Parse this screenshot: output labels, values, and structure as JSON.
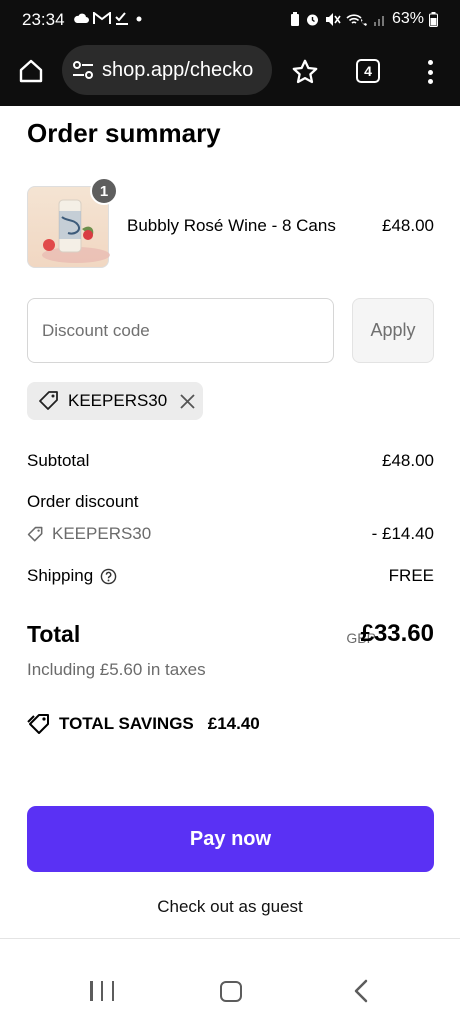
{
  "status_bar": {
    "time": "23:34",
    "battery": "63%"
  },
  "browser": {
    "url": "shop.app/checko",
    "tab_count": "4"
  },
  "order": {
    "title": "Order summary",
    "item": {
      "quantity": "1",
      "name": "Bubbly Rosé Wine - 8 Cans",
      "price": "£48.00"
    },
    "discount": {
      "placeholder": "Discount code",
      "apply_label": "Apply",
      "applied_code": "KEEPERS30"
    },
    "summary": {
      "subtotal_label": "Subtotal",
      "subtotal_value": "£48.00",
      "order_discount_label": "Order discount",
      "discount_code": "KEEPERS30",
      "discount_value": "- £14.40",
      "shipping_label": "Shipping",
      "shipping_value": "FREE"
    },
    "total": {
      "label": "Total",
      "currency": "GBP",
      "value": "£33.60",
      "tax_note": "Including £5.60 in taxes"
    },
    "savings": {
      "label": "TOTAL SAVINGS",
      "value": "£14.40"
    },
    "actions": {
      "pay_label": "Pay now",
      "guest_label": "Check out as guest"
    }
  },
  "colors": {
    "accent": "#5a31f4",
    "status_bar_bg": "#0e0e0e",
    "muted_text": "#6b6b6b"
  }
}
